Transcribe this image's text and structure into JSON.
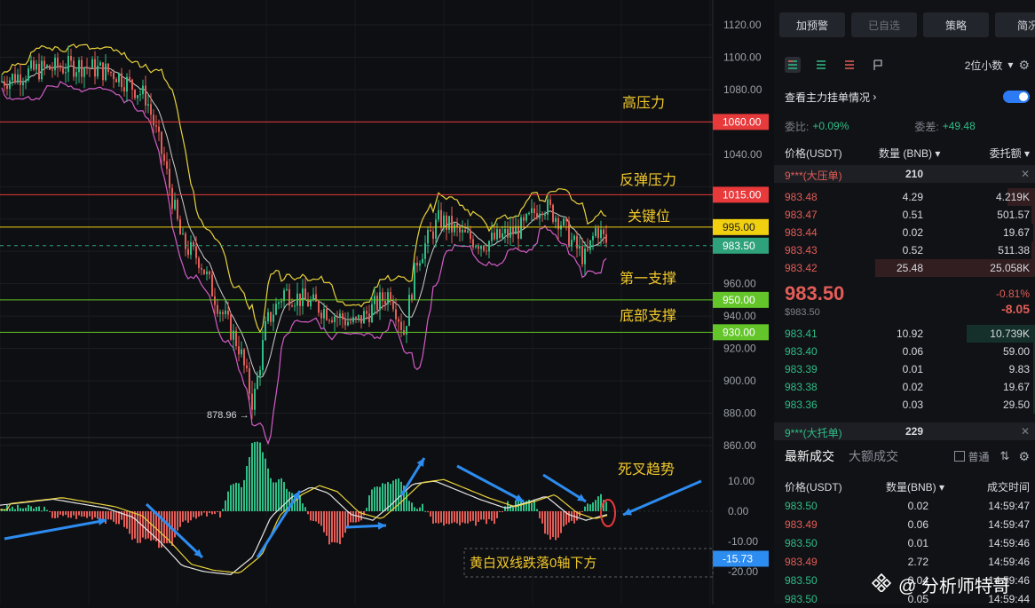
{
  "chart": {
    "price_axis": [
      "1120.00",
      "1100.00",
      "1080.00",
      "1040.00",
      "960.00",
      "940.00",
      "920.00",
      "900.00",
      "880.00",
      "860.00"
    ],
    "macd_axis": [
      "10.00",
      "0.00",
      "-10.00",
      "-20.00"
    ],
    "tags": [
      {
        "text": "1060.00",
        "bg": "#e8393b",
        "fg": "#ffffff"
      },
      {
        "text": "1015.00",
        "bg": "#e8393b",
        "fg": "#ffffff"
      },
      {
        "text": "995.00",
        "bg": "#f1d10f",
        "fg": "#222222"
      },
      {
        "text": "983.50",
        "bg": "#2ea37b",
        "fg": "#ffffff"
      },
      {
        "text": "950.00",
        "bg": "#63c52a",
        "fg": "#ffffff"
      },
      {
        "text": "930.00",
        "bg": "#63c52a",
        "fg": "#ffffff"
      },
      {
        "text": "-15.73",
        "bg": "#2d8cf0",
        "fg": "#ffffff"
      }
    ],
    "annotations": {
      "high_pressure": "高压力",
      "rebound_pressure": "反弹压力",
      "key_level": "关键位",
      "first_support": "第一支撑",
      "bottom_support": "底部支撑",
      "death_cross": "死叉趋势",
      "macd_note": "黄白双线跌落0轴下方",
      "low_mark": "878.96 →"
    },
    "colors": {
      "up": "#2fbd85",
      "down": "#e25d57",
      "boll_upper": "#e8d23c",
      "boll_lower": "#d45cc8",
      "mid": "#cfcfcf",
      "arrow": "#2d8cf0"
    }
  },
  "chart_data": {
    "type": "candlestick",
    "pair_price": 983.5,
    "levels": [
      {
        "label": "高压力",
        "value": 1060.0
      },
      {
        "label": "反弹压力",
        "value": 1015.0
      },
      {
        "label": "关键位",
        "value": 995.0
      },
      {
        "label": "第一支撑",
        "value": 950.0
      },
      {
        "label": "底部支撑",
        "value": 930.0
      }
    ],
    "low": 878.96,
    "ylim": [
      855,
      1125
    ],
    "macd_current": -15.73,
    "macd_ylim": [
      -25,
      15
    ]
  },
  "panel": {
    "buttons": [
      "加预警",
      "已自选",
      "策略",
      "简况"
    ],
    "decimals": "2位小数",
    "depth_toggle_label": "查看主力挂单情况",
    "ratio_label": "委比:",
    "ratio_value": "+0.09%",
    "diff_label": "委差:",
    "diff_value": "+49.48",
    "col_price": "价格(USDT)",
    "col_qty": "数量 (BNB)",
    "col_total": "委托额",
    "big_sell": {
      "name": "9***(大压单)",
      "qty": "210"
    },
    "asks": [
      {
        "p": "983.48",
        "q": "4.29",
        "t": "4.219K",
        "f": 0.17
      },
      {
        "p": "983.47",
        "q": "0.51",
        "t": "501.57",
        "f": 0.02
      },
      {
        "p": "983.44",
        "q": "0.02",
        "t": "19.67",
        "f": 0.01
      },
      {
        "p": "983.43",
        "q": "0.52",
        "t": "511.38",
        "f": 0.02
      },
      {
        "p": "983.42",
        "q": "25.48",
        "t": "25.058K",
        "f": 1.0
      }
    ],
    "last_price": "983.50",
    "last_usd": "$983.50",
    "change_pct": "-0.81%",
    "change_abs": "-8.05",
    "bids": [
      {
        "p": "983.41",
        "q": "10.92",
        "t": "10.739K",
        "f": 0.43
      },
      {
        "p": "983.40",
        "q": "0.06",
        "t": "59.00",
        "f": 0.01
      },
      {
        "p": "983.39",
        "q": "0.01",
        "t": "9.83",
        "f": 0.01
      },
      {
        "p": "983.38",
        "q": "0.02",
        "t": "19.67",
        "f": 0.01
      },
      {
        "p": "983.36",
        "q": "0.03",
        "t": "29.50",
        "f": 0.01
      }
    ],
    "big_buy": {
      "name": "9***(大托单)",
      "qty": "229"
    },
    "tab_trades": "最新成交",
    "tab_big": "大额成交",
    "normal_label": "普通",
    "trade_col_price": "价格(USDT)",
    "trade_col_qty": "数量(BNB)",
    "trade_col_time": "成交时间",
    "trades": [
      {
        "p": "983.50",
        "q": "0.02",
        "t": "14:59:47",
        "side": "buy"
      },
      {
        "p": "983.49",
        "q": "0.06",
        "t": "14:59:47",
        "side": "sell"
      },
      {
        "p": "983.50",
        "q": "0.01",
        "t": "14:59:46",
        "side": "buy"
      },
      {
        "p": "983.49",
        "q": "2.72",
        "t": "14:59:46",
        "side": "sell"
      },
      {
        "p": "983.50",
        "q": "0.04",
        "t": "14:59:46",
        "side": "buy"
      },
      {
        "p": "983.50",
        "q": "0.05",
        "t": "14:59:44",
        "side": "buy"
      }
    ],
    "watermark": "@ 分析师特哥"
  }
}
